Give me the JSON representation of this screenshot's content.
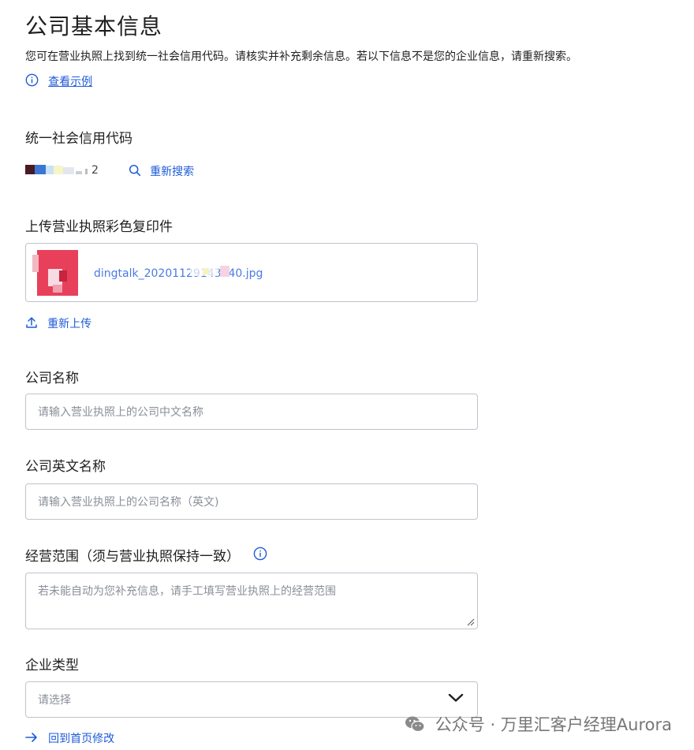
{
  "page": {
    "title": "公司基本信息",
    "subtitle": "您可在营业执照上找到统一社会信用代码。请核实并补充剩余信息。若以下信息不是您的企业信息，请重新搜索。",
    "example_link": "查看示例"
  },
  "credit_code": {
    "label": "统一社会信用代码",
    "value_suffix": "2",
    "research_label": "重新搜索"
  },
  "license_upload": {
    "label": "上传营业执照彩色复印件",
    "file_name": "dingtalk_20201129143140.jpg",
    "reupload_label": "重新上传"
  },
  "company_name": {
    "label": "公司名称",
    "placeholder": "请输入营业执照上的公司中文名称"
  },
  "company_en_name": {
    "label": "公司英文名称",
    "placeholder": "请输入营业执照上的公司名称（英文)"
  },
  "business_scope": {
    "label": "经营范围（须与营业执照保持一致）",
    "placeholder": "若未能自动为您补充信息，请手工填写营业执照上的经营范围"
  },
  "company_type": {
    "label": "企业类型",
    "placeholder": "请选择"
  },
  "back_link": "回到首页修改",
  "watermark": "公众号 · 万里汇客户经理Aurora",
  "colors": {
    "link": "#1e5bd8",
    "border": "#bfc4cc",
    "thumb": "#e8405a"
  }
}
